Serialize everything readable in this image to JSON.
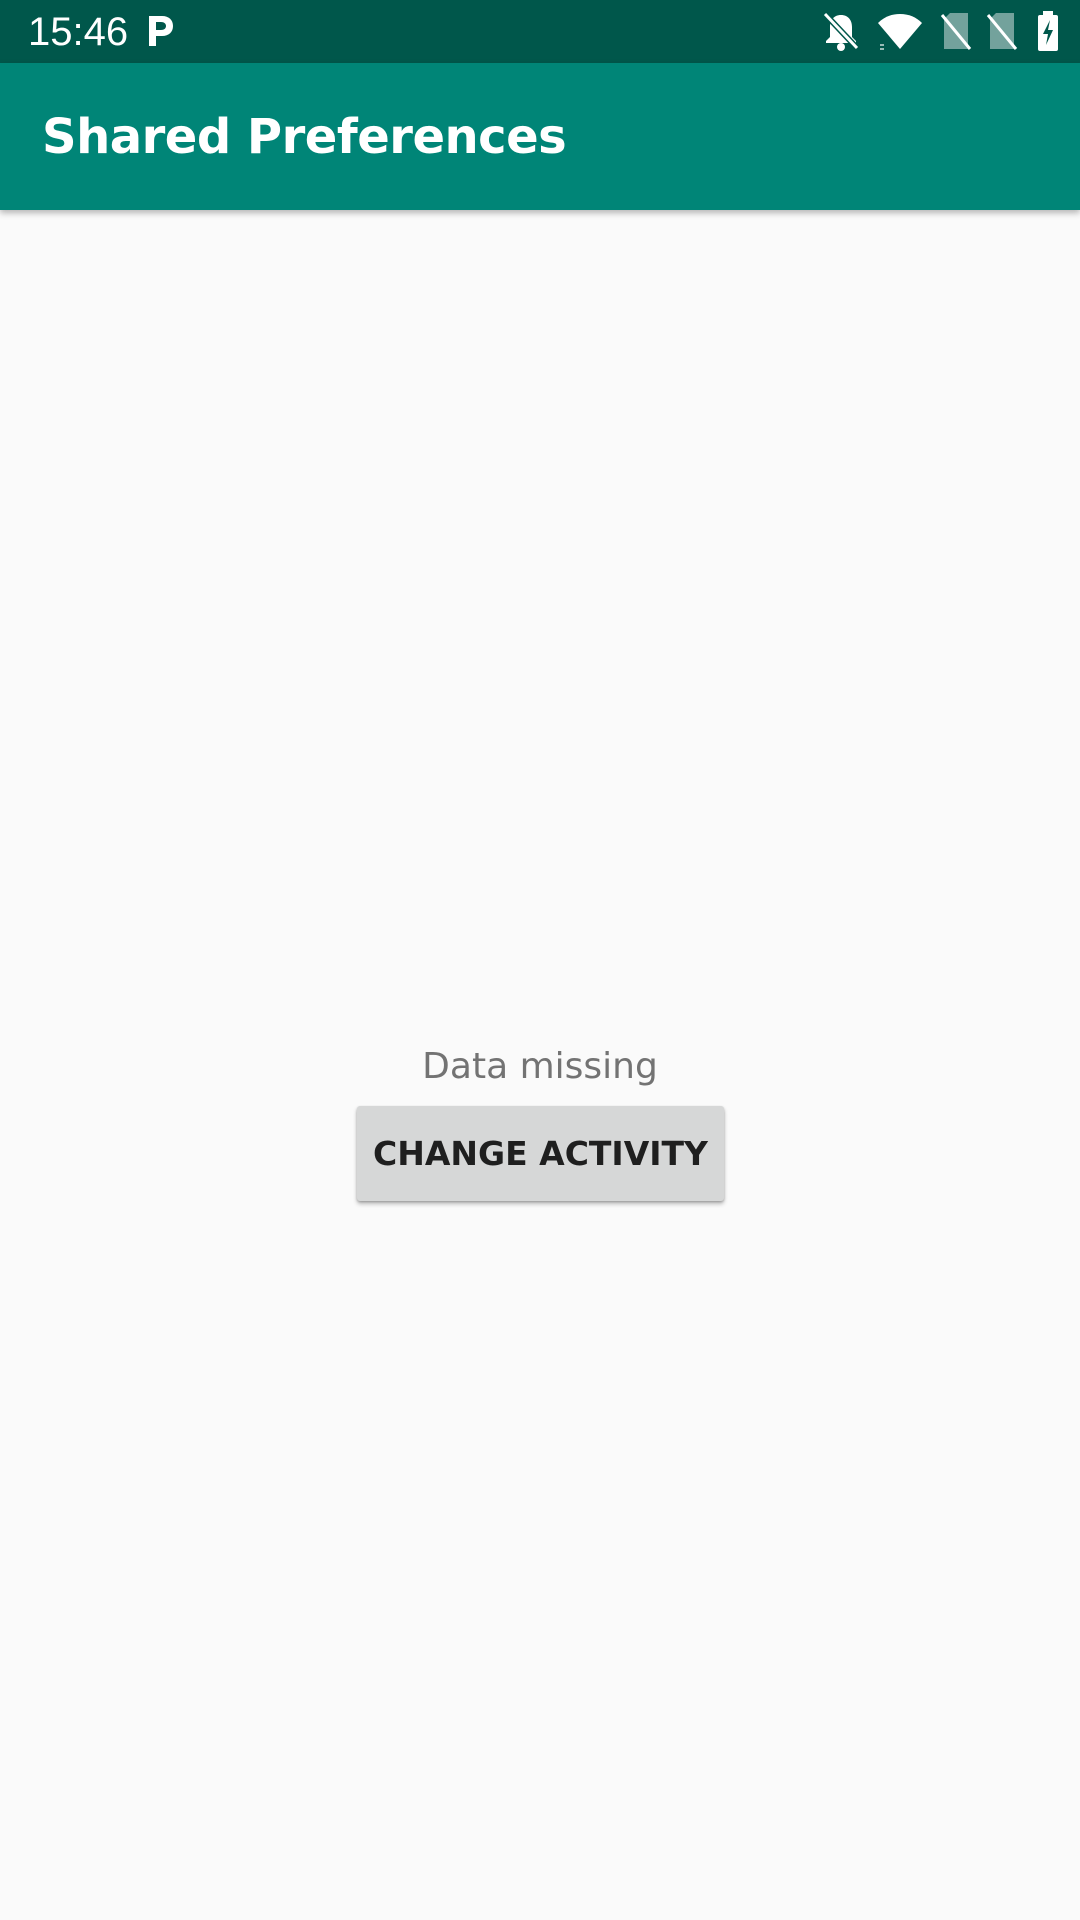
{
  "status_bar": {
    "time": "15:46",
    "icons": [
      "parking-icon",
      "notifications-off-icon",
      "wifi-icon",
      "no-sim-icon",
      "no-sim-icon",
      "battery-charging-icon"
    ]
  },
  "app_bar": {
    "title": "Shared Preferences"
  },
  "main": {
    "status_text": "Data missing",
    "button_label": "CHANGE ACTIVITY"
  },
  "colors": {
    "status_bar": "#00574b",
    "app_bar": "#008577",
    "background": "#fafafa",
    "button": "#d6d7d7"
  }
}
